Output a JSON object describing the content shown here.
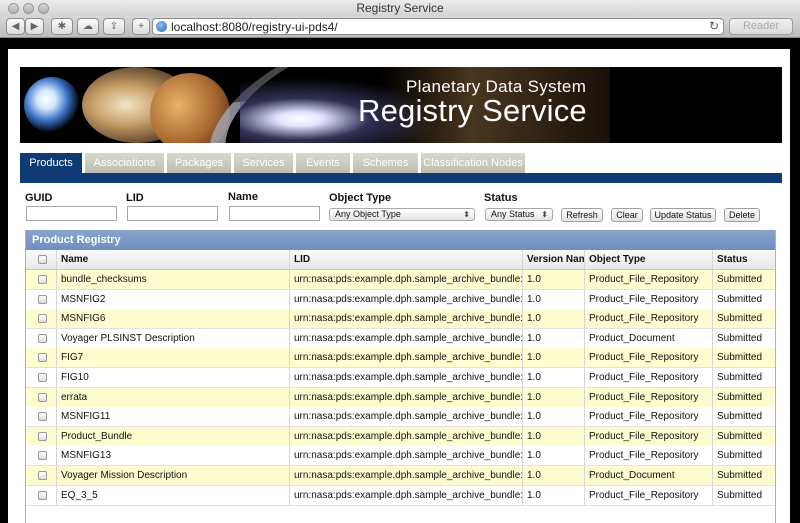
{
  "window": {
    "title": "Registry Service"
  },
  "browser": {
    "url": "localhost:8080/registry-ui-pds4/",
    "reader_label": "Reader"
  },
  "banner": {
    "subtitle": "Planetary Data System",
    "title": "Registry Service"
  },
  "tabs": [
    {
      "label": "Products"
    },
    {
      "label": "Associations"
    },
    {
      "label": "Packages"
    },
    {
      "label": "Services"
    },
    {
      "label": "Events"
    },
    {
      "label": "Schemes"
    },
    {
      "label": "Classification Nodes"
    }
  ],
  "filters": {
    "guid_label": "GUID",
    "lid_label": "LID",
    "name_label": "Name",
    "object_type_label": "Object Type",
    "object_type_value": "Any Object Type",
    "status_label": "Status",
    "status_value": "Any Status",
    "refresh_label": "Refresh",
    "clear_label": "Clear",
    "update_status_label": "Update Status",
    "delete_label": "Delete"
  },
  "grid": {
    "title": "Product Registry",
    "columns": [
      "Name",
      "LID",
      "Version Nam",
      "Object Type",
      "Status"
    ],
    "rows": [
      {
        "name": "bundle_checksums",
        "lid": "urn:nasa:pds:example.dph.sample_archive_bundle:do",
        "version": "1.0",
        "object_type": "Product_File_Repository",
        "status": "Submitted"
      },
      {
        "name": "MSNFIG2",
        "lid": "urn:nasa:pds:example.dph.sample_archive_bundle:do",
        "version": "1.0",
        "object_type": "Product_File_Repository",
        "status": "Submitted"
      },
      {
        "name": "MSNFIG6",
        "lid": "urn:nasa:pds:example.dph.sample_archive_bundle:do",
        "version": "1.0",
        "object_type": "Product_File_Repository",
        "status": "Submitted"
      },
      {
        "name": "Voyager PLSINST Description",
        "lid": "urn:nasa:pds:example.dph.sample_archive_bundle:do",
        "version": "1.0",
        "object_type": "Product_Document",
        "status": "Submitted"
      },
      {
        "name": "FIG7",
        "lid": "urn:nasa:pds:example.dph.sample_archive_bundle:do",
        "version": "1.0",
        "object_type": "Product_File_Repository",
        "status": "Submitted"
      },
      {
        "name": "FIG10",
        "lid": "urn:nasa:pds:example.dph.sample_archive_bundle:do",
        "version": "1.0",
        "object_type": "Product_File_Repository",
        "status": "Submitted"
      },
      {
        "name": "errata",
        "lid": "urn:nasa:pds:example.dph.sample_archive_bundle:do",
        "version": "1.0",
        "object_type": "Product_File_Repository",
        "status": "Submitted"
      },
      {
        "name": "MSNFIG11",
        "lid": "urn:nasa:pds:example.dph.sample_archive_bundle:do",
        "version": "1.0",
        "object_type": "Product_File_Repository",
        "status": "Submitted"
      },
      {
        "name": "Product_Bundle",
        "lid": "urn:nasa:pds:example.dph.sample_archive_bundle:Pr",
        "version": "1.0",
        "object_type": "Product_File_Repository",
        "status": "Submitted"
      },
      {
        "name": "MSNFIG13",
        "lid": "urn:nasa:pds:example.dph.sample_archive_bundle:do",
        "version": "1.0",
        "object_type": "Product_File_Repository",
        "status": "Submitted"
      },
      {
        "name": "Voyager Mission Description",
        "lid": "urn:nasa:pds:example.dph.sample_archive_bundle:do",
        "version": "1.0",
        "object_type": "Product_Document",
        "status": "Submitted"
      },
      {
        "name": "EQ_3_5",
        "lid": "urn:nasa:pds:example.dph.sample_archive_bundle:do",
        "version": "1.0",
        "object_type": "Product_File_Repository",
        "status": "Submitted"
      }
    ]
  },
  "colors": {
    "tab_active": "#0e3b73",
    "row_alt": "#fdfdcf",
    "grid_header": "#7a96c4"
  }
}
